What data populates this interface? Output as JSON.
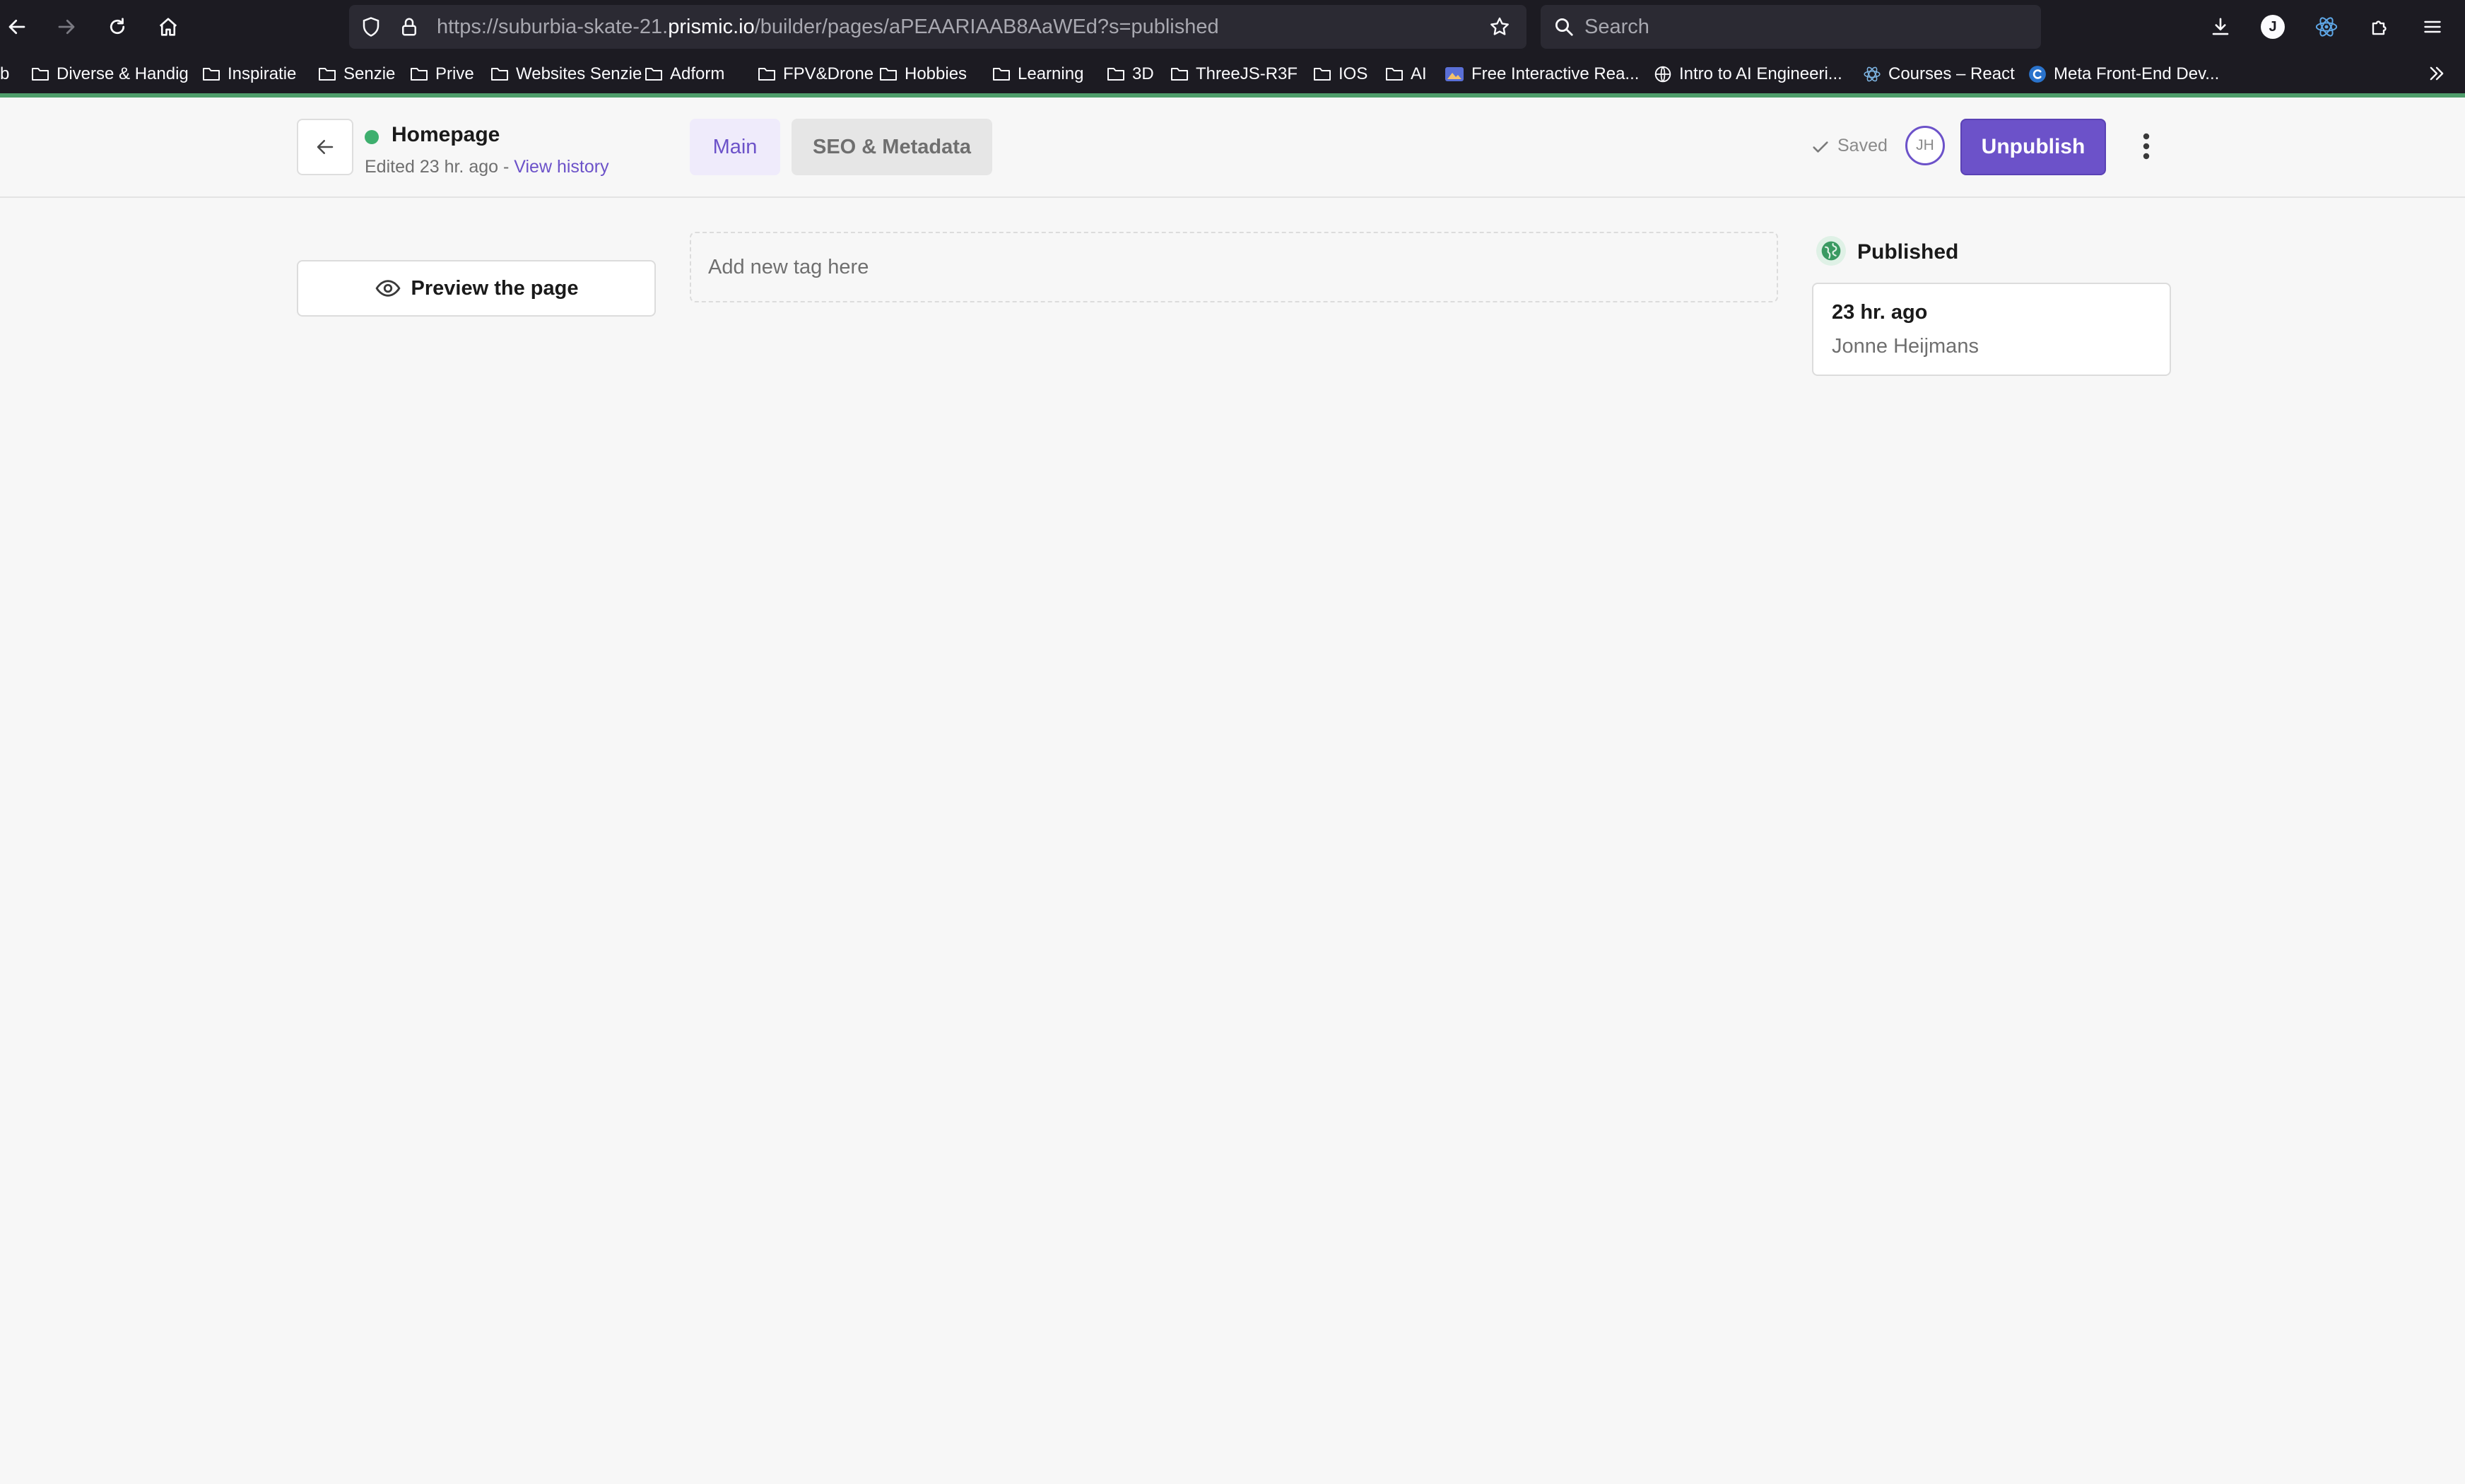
{
  "browser": {
    "url_prefix": "https://suburbia-skate-21.",
    "url_host": "prismic.io",
    "url_path": "/builder/pages/aPEAARIAAB8AaWEd?s=published",
    "search_placeholder": "Search",
    "profile_initial": "J",
    "bookmarks": [
      {
        "label": "b",
        "icon": "none"
      },
      {
        "label": "Diverse & Handig",
        "icon": "folder-icon"
      },
      {
        "label": "Inspiratie",
        "icon": "folder-icon"
      },
      {
        "label": "Senzie",
        "icon": "folder-icon"
      },
      {
        "label": "Prive",
        "icon": "folder-icon"
      },
      {
        "label": "Websites Senzie",
        "icon": "folder-icon"
      },
      {
        "label": "Adform",
        "icon": "folder-icon"
      },
      {
        "label": "FPV&Drone",
        "icon": "folder-icon"
      },
      {
        "label": "Hobbies",
        "icon": "folder-icon"
      },
      {
        "label": "Learning",
        "icon": "folder-icon"
      },
      {
        "label": "3D",
        "icon": "folder-icon"
      },
      {
        "label": "ThreeJS-R3F",
        "icon": "folder-icon"
      },
      {
        "label": "IOS",
        "icon": "folder-icon"
      },
      {
        "label": "AI",
        "icon": "folder-icon"
      },
      {
        "label": "Free Interactive Rea...",
        "icon": "site-favicon-icon"
      },
      {
        "label": "Intro to AI Engineeri...",
        "icon": "globe-icon"
      },
      {
        "label": "Courses – React",
        "icon": "react-icon"
      },
      {
        "label": "Meta Front-End Dev...",
        "icon": "coursera-icon"
      }
    ]
  },
  "header": {
    "document_title": "Homepage",
    "edited_text": "Edited 23 hr. ago - ",
    "view_history_label": "View history",
    "tabs": [
      {
        "label": "Main",
        "active": true
      },
      {
        "label": "SEO & Metadata",
        "active": false
      }
    ],
    "saved_label": "Saved",
    "avatar_initials": "JH",
    "unpublish_label": "Unpublish"
  },
  "main": {
    "preview_label": "Preview the page",
    "tag_placeholder": "Add new tag here"
  },
  "status_panel": {
    "status_label": "Published",
    "time": "23 hr. ago",
    "author": "Jonne Heijmans"
  },
  "colors": {
    "accent": "#6c52c9",
    "status_green": "#3eaf6e",
    "browser_dark": "#1c1b22"
  }
}
